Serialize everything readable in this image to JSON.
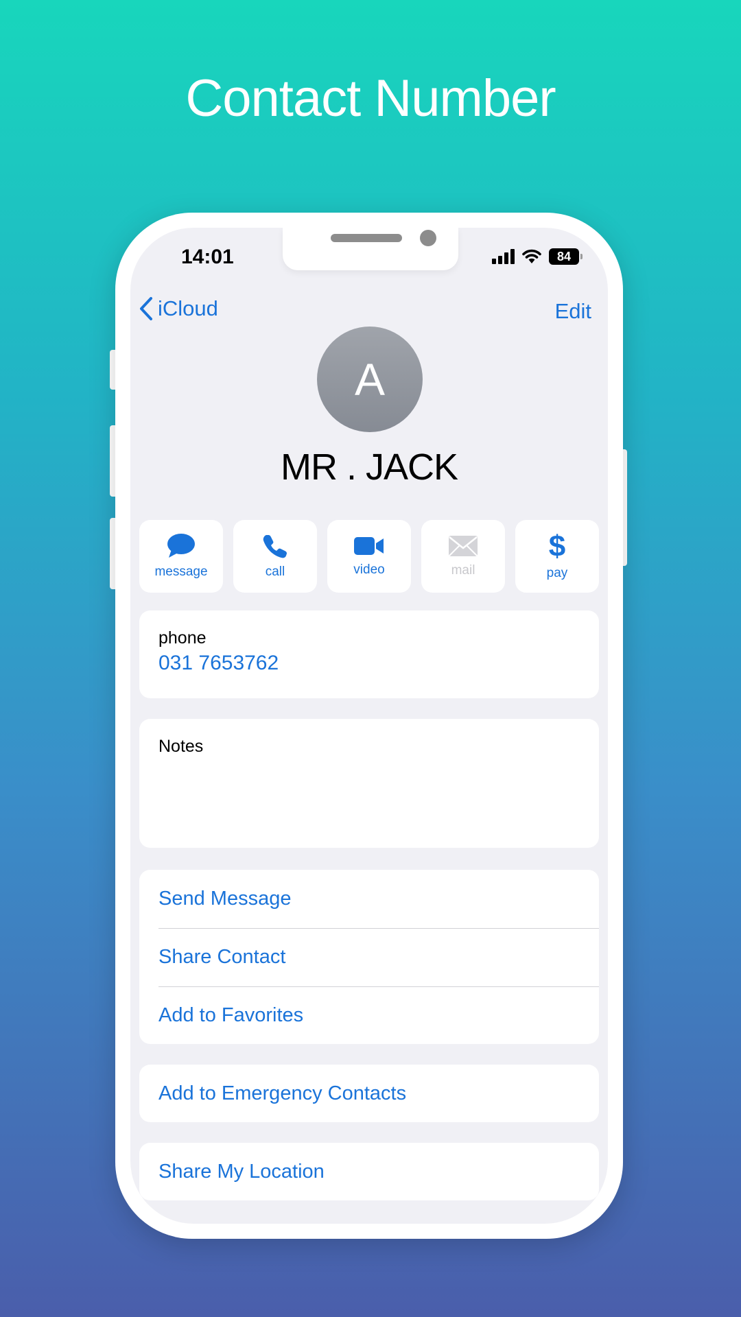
{
  "headline": "Contact Number",
  "status_bar": {
    "time": "14:01",
    "battery": "84",
    "icons": [
      "signal-icon",
      "wifi-icon",
      "battery-icon"
    ]
  },
  "nav": {
    "back_label": "iCloud",
    "edit_label": "Edit"
  },
  "contact": {
    "initial": "A",
    "name": "MR . JACK"
  },
  "actions": [
    {
      "label": "message",
      "icon": "message-icon",
      "enabled": true
    },
    {
      "label": "call",
      "icon": "phone-icon",
      "enabled": true
    },
    {
      "label": "video",
      "icon": "video-icon",
      "enabled": true
    },
    {
      "label": "mail",
      "icon": "mail-icon",
      "enabled": false
    },
    {
      "label": "pay",
      "icon": "dollar-icon",
      "enabled": true
    }
  ],
  "phone": {
    "label": "phone",
    "number": "031 7653762"
  },
  "notes": {
    "label": "Notes"
  },
  "list": [
    {
      "label": "Send Message"
    },
    {
      "label": "Share Contact"
    },
    {
      "label": "Add to Favorites"
    }
  ],
  "emergency": {
    "label": "Add to Emergency Contacts"
  },
  "location": {
    "label": "Share My Location"
  },
  "colors": {
    "accent": "#1a73d9",
    "screen_bg": "#f0f0f5",
    "gradient_top": "#18d6bc",
    "gradient_bottom": "#4a5eab",
    "disabled": "#c8c8cc"
  }
}
